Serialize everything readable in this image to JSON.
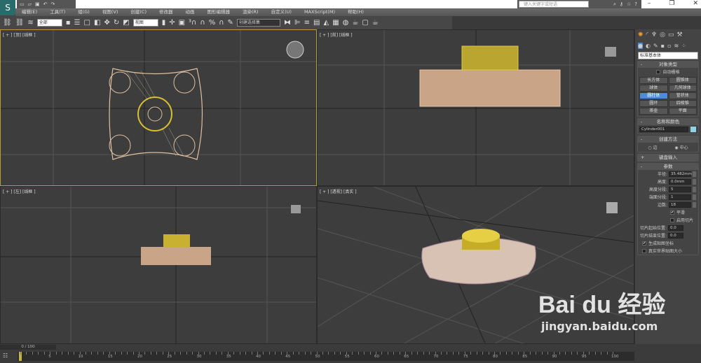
{
  "app": {
    "logo": "S"
  },
  "quick_access": [
    "new-icon",
    "open-icon",
    "save-icon",
    "undo-icon",
    "redo-icon"
  ],
  "search": {
    "placeholder": "键入关键字或短语"
  },
  "menu": [
    "编辑(E)",
    "工具(T)",
    "组(G)",
    "视图(V)",
    "创建(C)",
    "修改器",
    "动画",
    "图形编辑器",
    "渲染(R)",
    "自定义(U)",
    "MAXScript(M)",
    "帮助(H)"
  ],
  "toolbar": {
    "filter": "全部",
    "coord": "视图",
    "selection_set": "创建选择集"
  },
  "viewports": [
    {
      "label": "[ + ] [顶] [线框 ]"
    },
    {
      "label": "[ + ] [前] [线框 ]"
    },
    {
      "label": "[ + ] [左] [线框 ]"
    },
    {
      "label": "[ + ] [透视] [真实 ]"
    }
  ],
  "panel": {
    "category": "标准基本体",
    "object_type": {
      "title": "对象类型",
      "autogrid": "自动栅格",
      "buttons": [
        "长方体",
        "圆锥体",
        "球体",
        "几何球体",
        "圆柱体",
        "管状体",
        "圆环",
        "四棱锥",
        "茶壶",
        "平面"
      ],
      "active": "圆柱体"
    },
    "name_color": {
      "title": "名称和颜色",
      "name": "Cylinder001",
      "color": "#8fd3e6"
    },
    "creation": {
      "title": "创建方法",
      "options": [
        "边",
        "中心"
      ],
      "selected": "中心"
    },
    "keyboard": {
      "title": "键盘输入"
    },
    "params": {
      "title": "参数",
      "fields": [
        {
          "label": "半径:",
          "value": "35.482mm"
        },
        {
          "label": "高度:",
          "value": "0.0mm"
        },
        {
          "label": "高度分段:",
          "value": "5"
        },
        {
          "label": "端面分段:",
          "value": "1"
        },
        {
          "label": "边数:",
          "value": "18"
        }
      ],
      "smooth": "平滑",
      "slice_on": "启用切片",
      "slice_from": {
        "label": "切片起始位置:",
        "value": "0.0"
      },
      "slice_to": {
        "label": "切片结束位置:",
        "value": "0.0"
      },
      "gen_map": "生成贴图坐标",
      "real_world": "真实世界贴图大小"
    }
  },
  "timeline": {
    "frame": "0 / 100",
    "ticks": [
      "0",
      "5",
      "10",
      "15",
      "20",
      "25",
      "30",
      "35",
      "40",
      "45",
      "50",
      "55",
      "60",
      "65",
      "70",
      "75",
      "80",
      "85",
      "90",
      "95",
      "100"
    ]
  },
  "watermark": {
    "brand": "Bai du 经验",
    "url": "jingyan.baidu.com"
  }
}
